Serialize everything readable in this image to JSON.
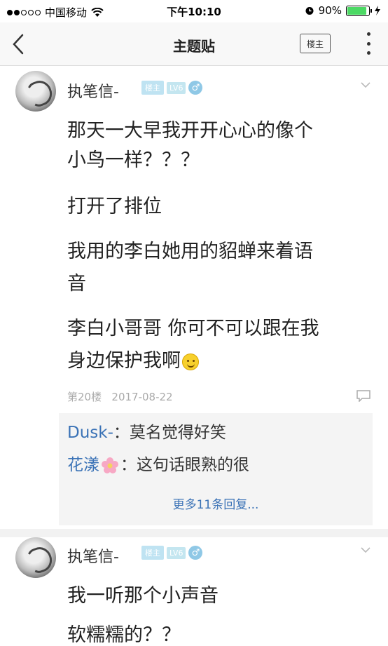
{
  "status_bar": {
    "carrier": "中国移动",
    "time": "下午10:10",
    "battery_percent": "90%",
    "battery_level": 0.9
  },
  "nav": {
    "title": "主题贴",
    "lz_button": "楼主"
  },
  "posts": [
    {
      "author": "执笔信-",
      "badge_lz": "楼主",
      "badge_level": "LV6",
      "gender": "♂",
      "lines": [
        "那天一大早我开开心心的像个",
        "小鸟一样？？？",
        "打开了排位",
        "我用的李白她用的貂蝉来着语",
        "音",
        "李白小哥哥 你可不可以跟在我",
        "身边保护我啊"
      ],
      "floor": "第20楼",
      "date": "2017-08-22",
      "replies": [
        {
          "who": "Dusk-",
          "text": "：莫名觉得好笑"
        },
        {
          "who": "花漾",
          "text": "：这句话眼熟的很"
        }
      ],
      "more_replies": "更多11条回复..."
    },
    {
      "author": "执笔信-",
      "badge_lz": "楼主",
      "badge_level": "LV6",
      "gender": "♂",
      "lines": [
        "我一听那个小声音",
        "软糯糯的？？"
      ]
    }
  ],
  "colors": {
    "link": "#3a72b6",
    "badge": "#bfe3f2",
    "battery": "#4cd964"
  }
}
